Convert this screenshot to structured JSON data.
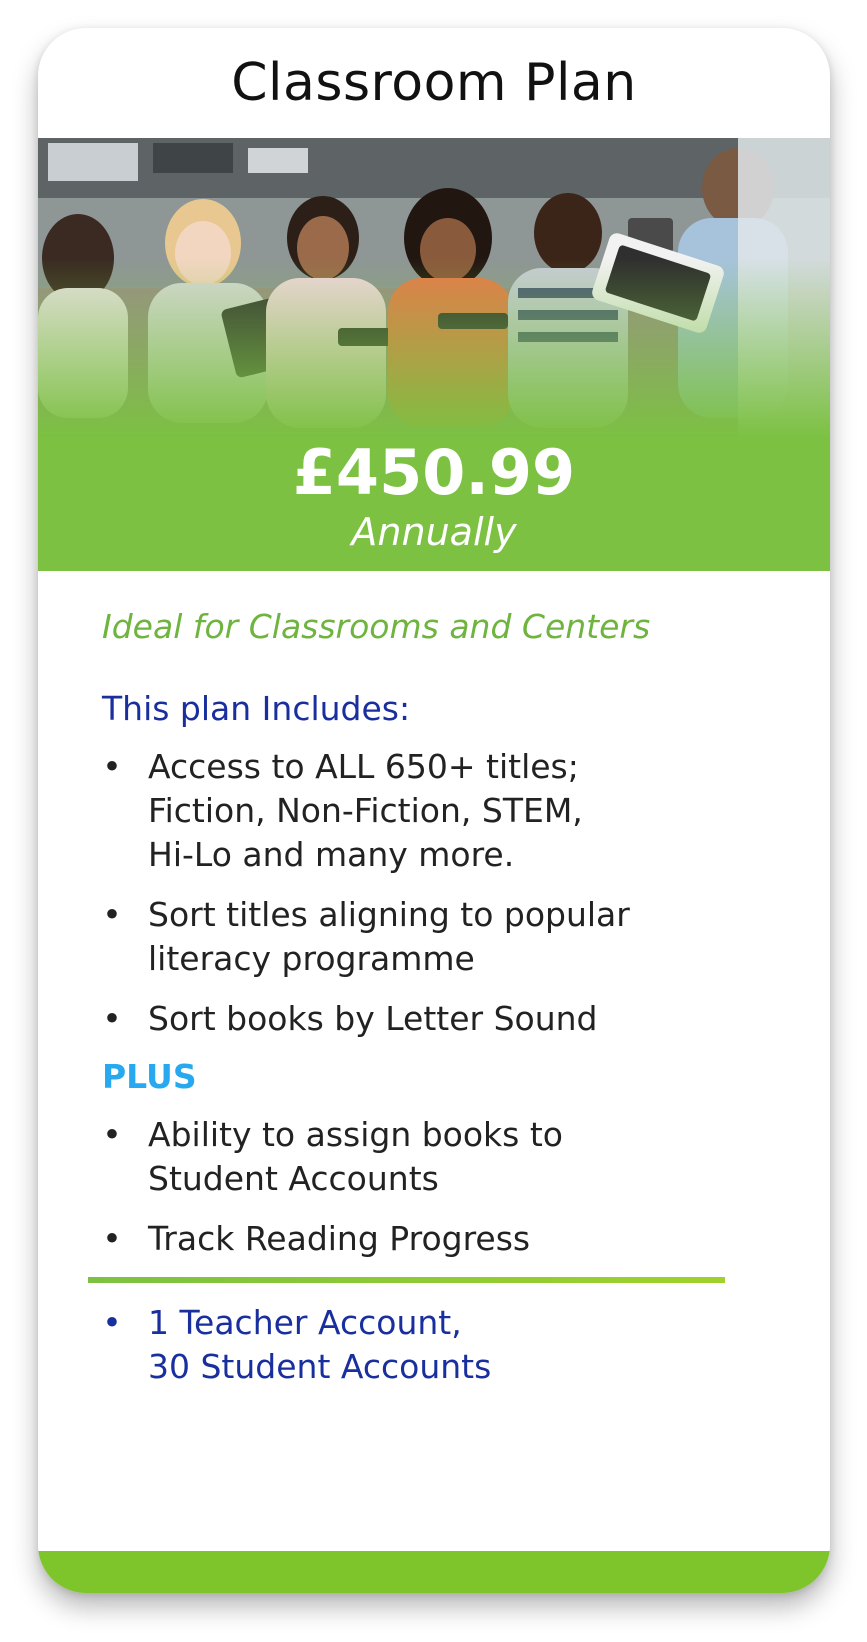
{
  "plan": {
    "title": "Classroom Plan",
    "price": "£450.99",
    "period": "Annually",
    "tagline": "Ideal for Classrooms and Centers",
    "includes_heading": "This plan Includes:",
    "includes": [
      "Access to ALL 650+ titles;\nFiction, Non-Fiction, STEM,\nHi-Lo and many more.",
      "Sort titles aligning to popular\nliteracy programme",
      "Sort books by Letter Sound"
    ],
    "plus_heading": "PLUS",
    "plus_items": [
      "Ability to assign books to\nStudent Accounts",
      "Track Reading Progress"
    ],
    "accounts": "1 Teacher Account,\n30 Student Accounts",
    "bullet": "•"
  },
  "colors": {
    "accent_green": "#7cc142",
    "heading_blue": "#1a2f9e",
    "plus_blue": "#28a8ee"
  }
}
